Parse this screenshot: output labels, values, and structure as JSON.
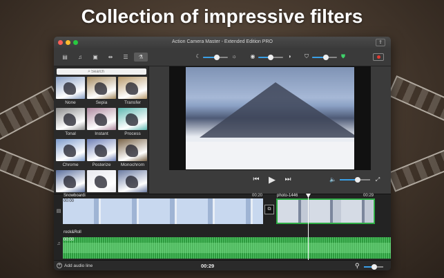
{
  "headline": "Collection of impressive filters",
  "window": {
    "title": "Action Camera Master - Extended Edition PRO",
    "share_icon": "share-icon"
  },
  "toolbar": {
    "tabs": [
      {
        "icon": "film-icon",
        "glyph": "▤"
      },
      {
        "icon": "music-icon",
        "glyph": "♫"
      },
      {
        "icon": "image-icon",
        "glyph": "▣"
      },
      {
        "icon": "transition-icon",
        "glyph": "⇹"
      },
      {
        "icon": "text-icon",
        "glyph": "☰"
      },
      {
        "icon": "filters-icon",
        "glyph": "⚗"
      }
    ],
    "active_tab": 5,
    "brightness": 0.55,
    "exposure": 0.5,
    "contrast": 0.55,
    "record_icon": "record-icon"
  },
  "sidebar": {
    "search_placeholder": "Search",
    "filters": [
      {
        "name": "None",
        "tint": "#8aa0c4"
      },
      {
        "name": "Sepia",
        "tint": "#a58a5e"
      },
      {
        "name": "Transfer",
        "tint": "#b89a6b"
      },
      {
        "name": "Tonal",
        "tint": "#8c8c8c"
      },
      {
        "name": "Instant",
        "tint": "#b08aa0"
      },
      {
        "name": "Process",
        "tint": "#5fb9b2"
      },
      {
        "name": "Chrome",
        "tint": "#7e9ccc"
      },
      {
        "name": "Posterize",
        "tint": "#6e7fb6"
      },
      {
        "name": "Monochrom",
        "tint": "#7a6448"
      },
      {
        "name": "",
        "tint": "#5a6e9c"
      },
      {
        "name": "",
        "tint": "#e8e8ee"
      },
      {
        "name": "",
        "tint": "#6a7aa2"
      }
    ]
  },
  "player": {
    "prev_glyph": "⏮",
    "play_glyph": "▶",
    "next_glyph": "⏭",
    "volume": 0.6
  },
  "timeline": {
    "video_clip": {
      "label": "Snowboardi",
      "start": "00:00",
      "end": "00:20"
    },
    "photo_clip": {
      "label": "photo-1446",
      "end": "00:29"
    },
    "audio_clip": {
      "label": "rock&Roll",
      "start": "00:00"
    },
    "add_audio_label": "Add audio line",
    "total_time": "00:29",
    "zoom": 0.55
  }
}
